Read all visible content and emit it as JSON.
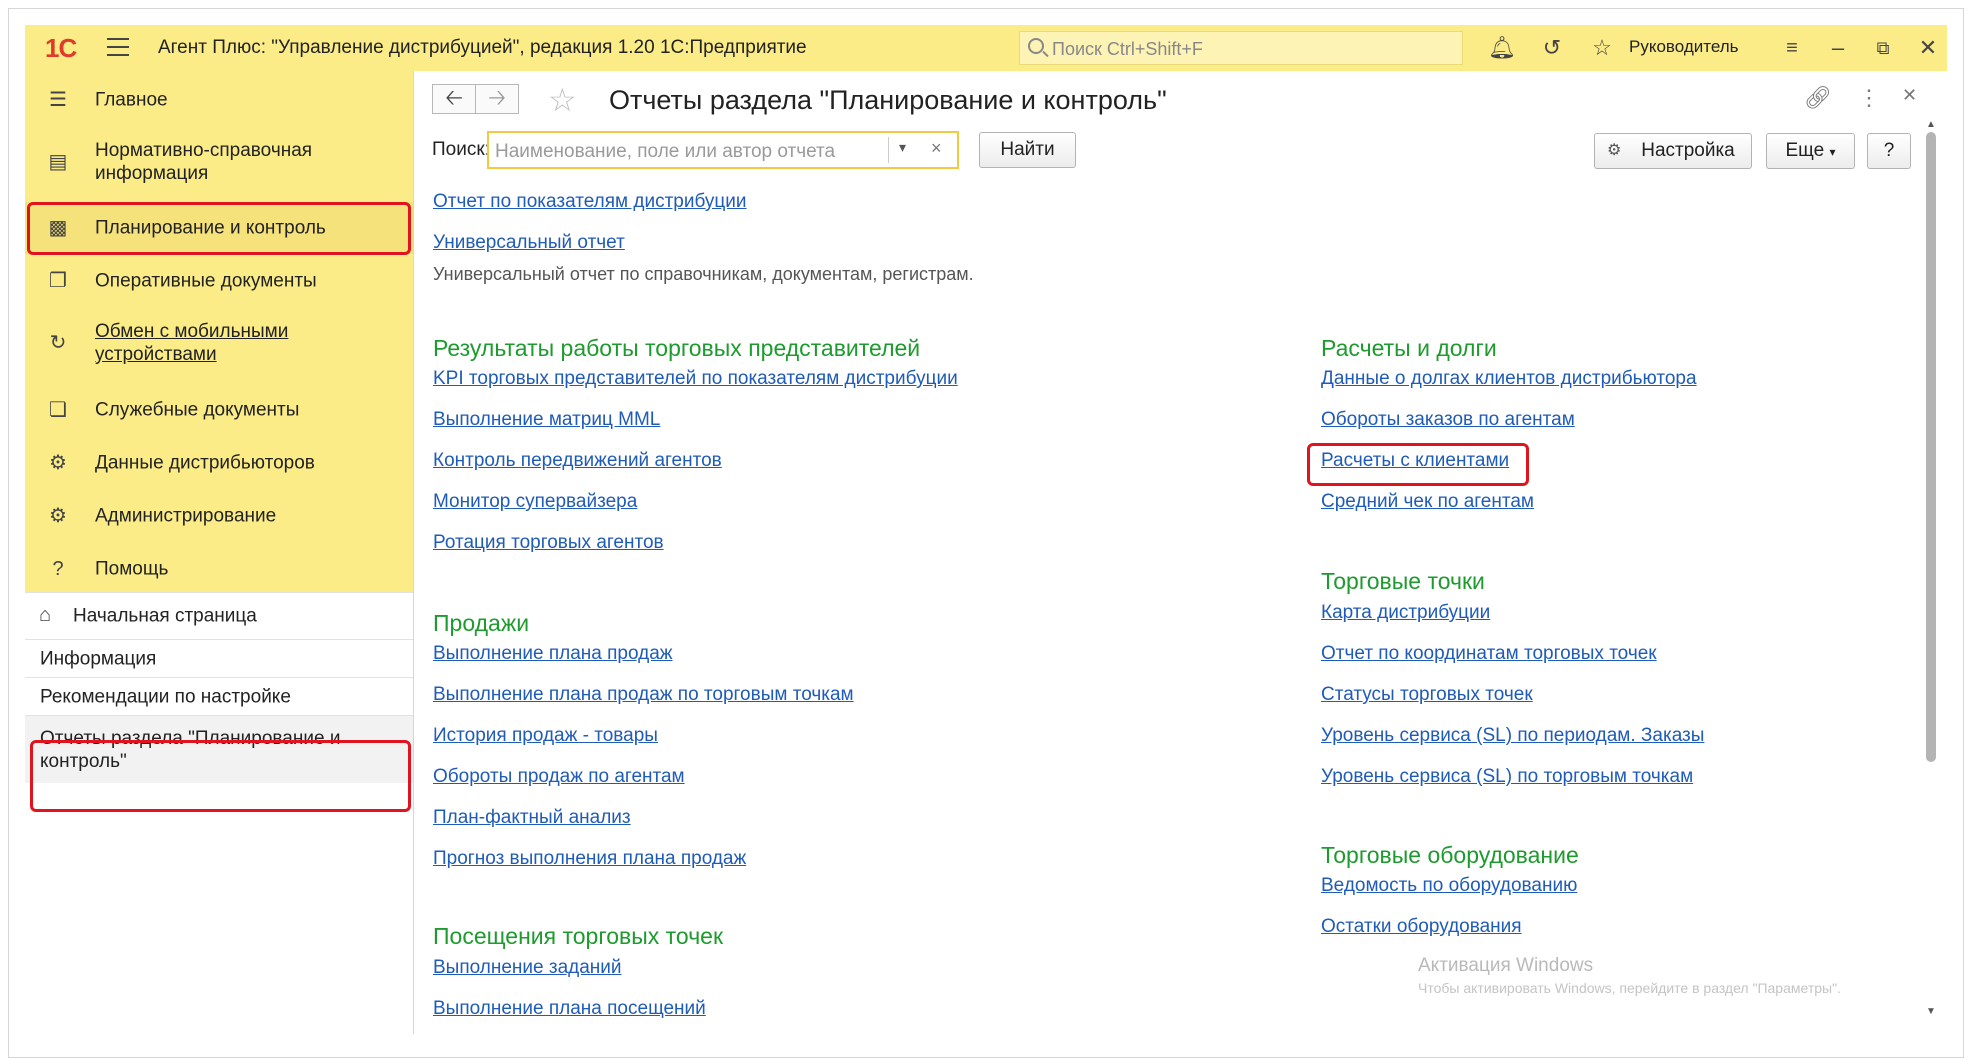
{
  "app": {
    "logo": "1С",
    "title": "Агент Плюс: \"Управление дистрибуцией\", редакция 1.20 1С:Предприятие",
    "global_search_placeholder": "Поиск Ctrl+Shift+F",
    "user": "Руководитель"
  },
  "sidebar": {
    "sections": [
      {
        "label": "Главное",
        "icon": "menu-icon"
      },
      {
        "label": "Нормативно-справочная информация",
        "icon": "columns-icon"
      },
      {
        "label": "Планирование и контроль",
        "icon": "bar-chart-icon"
      },
      {
        "label": "Оперативные документы",
        "icon": "documents-icon"
      },
      {
        "label": "Обмен с мобильными устройствами",
        "icon": "sync-icon"
      },
      {
        "label": "Служебные документы",
        "icon": "service-documents-icon"
      },
      {
        "label": "Данные дистрибьюторов",
        "icon": "distributor-icon"
      },
      {
        "label": "Администрирование",
        "icon": "gear-icon"
      },
      {
        "label": "Помощь",
        "icon": "help-icon"
      }
    ],
    "open_windows": [
      {
        "label": "Начальная страница",
        "icon": "home-icon"
      },
      {
        "label": "Информация"
      },
      {
        "label": "Рекомендации по настройке"
      },
      {
        "label": "Отчеты раздела \"Планирование и контроль\""
      }
    ]
  },
  "main": {
    "title": "Отчеты раздела \"Планирование и контроль\"",
    "search_label": "Поиск:",
    "search_placeholder": "Наименование, поле или автор отчета",
    "find_button": "Найти",
    "settings_button": "Настройка",
    "more_button": "Еще",
    "help_button": "?",
    "top_reports": [
      {
        "label": "Отчет по показателям дистрибуции"
      },
      {
        "label": "Универсальный отчет",
        "description": "Универсальный отчет по справочникам, документам, регистрам."
      }
    ],
    "left_groups": [
      {
        "title": "Результаты работы торговых представителей",
        "items": [
          "KPI торговых представителей по показателям дистрибуции",
          "Выполнение матриц MML",
          "Контроль передвижений агентов",
          "Монитор супервайзера",
          "Ротация торговых агентов"
        ]
      },
      {
        "title": "Продажи",
        "items": [
          "Выполнение плана продаж",
          "Выполнение плана продаж по торговым точкам",
          "История продаж - товары",
          "Обороты продаж по агентам",
          "План-фактный анализ",
          "Прогноз выполнения плана продаж"
        ]
      },
      {
        "title": "Посещения торговых точек",
        "items": [
          "Выполнение заданий",
          "Выполнение плана посещений"
        ]
      }
    ],
    "right_groups": [
      {
        "title": "Расчеты и долги",
        "items": [
          "Данные о долгах клиентов дистрибьютора",
          "Обороты заказов по агентам",
          "Расчеты с клиентами",
          "Средний чек по агентам"
        ]
      },
      {
        "title": "Торговые точки",
        "items": [
          "Карта дистрибуции",
          "Отчет по координатам торговых точек",
          "Статусы торговых точек",
          "Уровень сервиса (SL) по периодам. Заказы",
          "Уровень сервиса (SL) по торговым точкам"
        ]
      },
      {
        "title": "Торговые оборудование",
        "items": [
          "Ведомость по оборудованию",
          "Остатки оборудования"
        ]
      }
    ]
  },
  "watermark": {
    "line1": "Активация Windows",
    "line2": "Чтобы активировать Windows, перейдите в раздел \"Параметры\"."
  },
  "colors": {
    "titlebar": "#fbec88",
    "link": "#1f5bb8",
    "group_heading": "#1e9b2e",
    "highlight": "#e0141e"
  }
}
